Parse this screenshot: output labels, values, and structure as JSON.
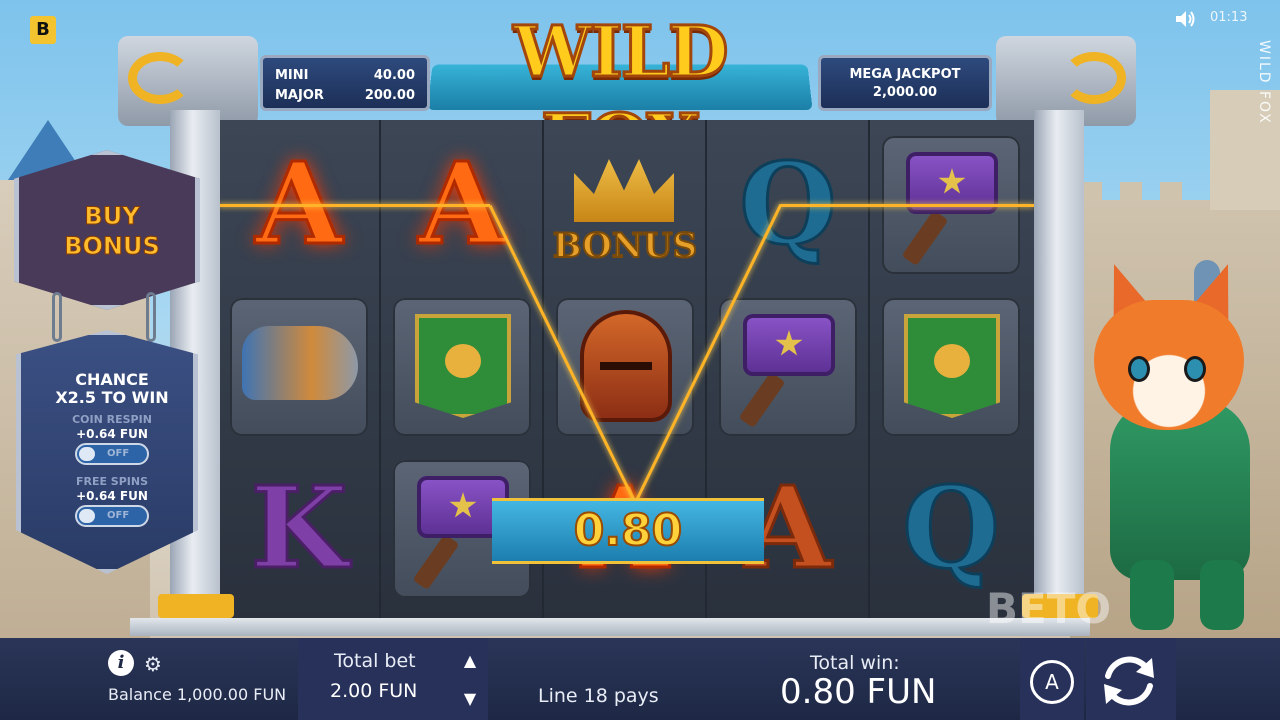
{
  "brand_badge": "B",
  "status": {
    "time": "01:13"
  },
  "game": {
    "title": "WILD FOX",
    "side_title": "WILD FOX"
  },
  "jackpots": {
    "mini_label": "MINI",
    "mini_value": "40.00",
    "major_label": "MAJOR",
    "major_value": "200.00",
    "mega_label": "MEGA JACKPOT",
    "mega_value": "2,000.00"
  },
  "buy_bonus": {
    "line1": "BUY",
    "line2": "BONUS"
  },
  "chance_panel": {
    "title_line1": "CHANCE",
    "title_line2": "X2.5 TO WIN",
    "coin_respin_label": "COIN RESPIN",
    "coin_respin_value": "+0.64 FUN",
    "coin_respin_toggle": "OFF",
    "free_spins_label": "FREE SPINS",
    "free_spins_value": "+0.64 FUN",
    "free_spins_toggle": "OFF"
  },
  "reels": [
    [
      "A",
      "horn",
      "K"
    ],
    [
      "A",
      "banner",
      "hammer"
    ],
    [
      "bonus",
      "helmet",
      "A"
    ],
    [
      "Q",
      "hammer",
      "A"
    ],
    [
      "hammer",
      "banner",
      "Q"
    ]
  ],
  "reel_bonus_text": "BONUS",
  "win_banner": {
    "amount": "0.80"
  },
  "watermark": "BETO",
  "bottom_bar": {
    "balance": "Balance 1,000.00 FUN",
    "total_bet_label": "Total bet",
    "total_bet_value": "2.00 FUN",
    "line_pays": "Line 18 pays",
    "total_win_label": "Total win:",
    "total_win_value": "0.80 FUN",
    "auto_label": "A"
  },
  "icons": {
    "info": "info-icon",
    "settings": "gear-icon",
    "sound": "speaker-icon",
    "bet_up": "triangle-up-icon",
    "bet_down": "triangle-down-icon",
    "autoplay": "autoplay-icon",
    "spin": "spin-icon"
  },
  "colors": {
    "accent_gold": "#ffb326",
    "panel_blue": "#2a3558",
    "win_banner": "#1c7eaf"
  }
}
